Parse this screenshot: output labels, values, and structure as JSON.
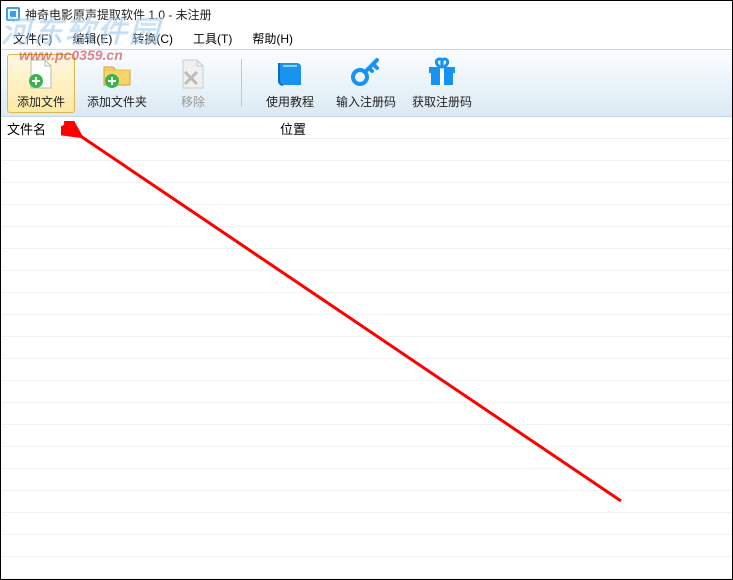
{
  "title": "神奇电影原声提取软件 1.0 - 未注册",
  "menu": {
    "file": "文件(F)",
    "edit": "编辑(E)",
    "convert": "转换(C)",
    "tools": "工具(T)",
    "help": "帮助(H)"
  },
  "toolbar": {
    "add_file": "添加文件",
    "add_folder": "添加文件夹",
    "remove": "移除",
    "tutorial": "使用教程",
    "enter_code": "输入注册码",
    "get_code": "获取注册码"
  },
  "columns": {
    "filename": "文件名",
    "location": "位置"
  },
  "watermark": {
    "line1": "河东软件园",
    "line2": "www.pc0359.cn"
  }
}
